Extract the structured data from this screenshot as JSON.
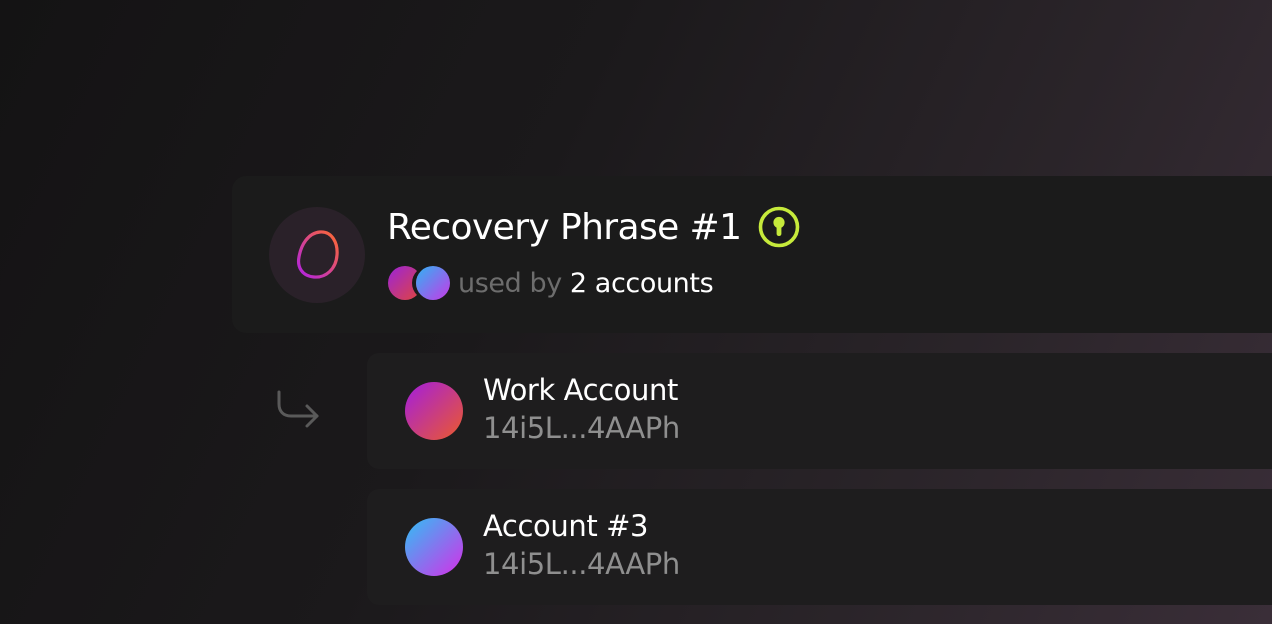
{
  "recovery_phrase": {
    "title": "Recovery Phrase #1",
    "icon": "phrase-blob-icon",
    "badge_icon": "key-icon",
    "used_by_label": "used by",
    "used_by_count": "2 accounts"
  },
  "accounts": [
    {
      "name": "Work Account",
      "address": "14i5L...4AAPh",
      "avatar": "gradient-purple-orange"
    },
    {
      "name": "Account #3",
      "address": "14i5L...4AAPh",
      "avatar": "gradient-blue-pink"
    }
  ],
  "colors": {
    "accent_key": "#c6ea3b",
    "card_background": "#1b1b1b",
    "text_primary": "#ffffff",
    "text_muted": "#8f8f8f"
  }
}
